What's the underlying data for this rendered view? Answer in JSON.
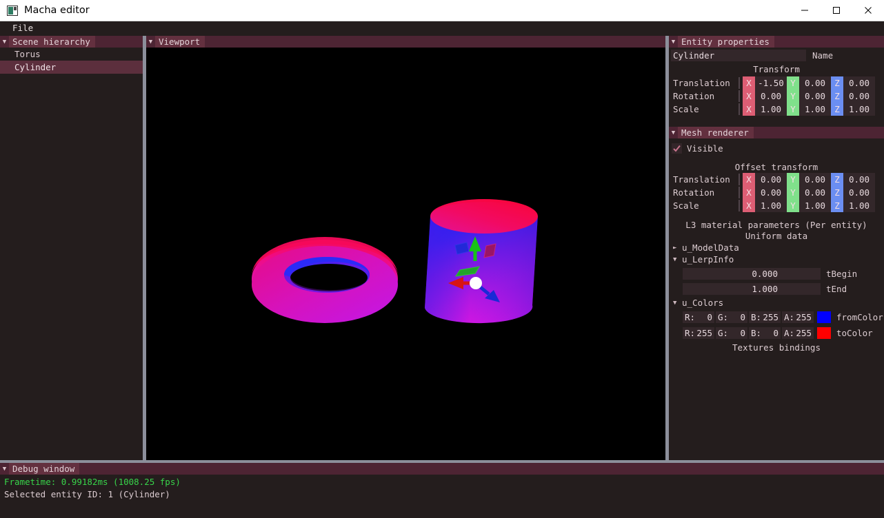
{
  "window": {
    "title": "Macha editor",
    "icon": "app-icon",
    "minimize_label": "minimize-icon",
    "maximize_label": "maximize-icon",
    "close_label": "close-icon"
  },
  "menubar": {
    "file_label": "File"
  },
  "scene_hierarchy": {
    "header": "Scene hierarchy",
    "collapse_glyph": "▼",
    "items": [
      {
        "label": "Torus",
        "selected": false
      },
      {
        "label": "Cylinder",
        "selected": true
      }
    ]
  },
  "viewport": {
    "header": "Viewport",
    "collapse_glyph": "▼",
    "background": "#000000",
    "objects": [
      {
        "name": "torus",
        "color_outer": "#f0138c",
        "color_inner": "#2b2bf5"
      },
      {
        "name": "cylinder",
        "color_top": "#f0136e",
        "color_body_left": "#3a23e8",
        "color_body_bottom": "#d41ae0"
      }
    ],
    "gizmo": {
      "x_axis_color": "#d81414",
      "y_axis_color": "#18c218",
      "z_axis_color": "#1a2ad6",
      "center_color": "#ffffff"
    }
  },
  "entity_properties": {
    "header": "Entity properties",
    "collapse_glyph": "▼",
    "name_value": "Cylinder",
    "name_label": "Name",
    "transform": {
      "title": "Transform",
      "rows": [
        {
          "label": "Translation",
          "x": "-1.50",
          "y": "0.00",
          "z": "0.00"
        },
        {
          "label": "Rotation",
          "x": "0.00",
          "y": "0.00",
          "z": "0.00"
        },
        {
          "label": "Scale",
          "x": "1.00",
          "y": "1.00",
          "z": "1.00"
        }
      ],
      "axis_labels": {
        "x": "X",
        "y": "Y",
        "z": "Z"
      },
      "axis_colors": {
        "x": "#dd5e74",
        "y": "#80e08b",
        "z": "#6b8ef2"
      }
    }
  },
  "mesh_renderer": {
    "header": "Mesh renderer",
    "collapse_glyph": "▼",
    "visible_label": "Visible",
    "visible_checked": true,
    "offset_transform": {
      "title": "Offset transform",
      "rows": [
        {
          "label": "Translation",
          "x": "0.00",
          "y": "0.00",
          "z": "0.00"
        },
        {
          "label": "Rotation",
          "x": "0.00",
          "y": "0.00",
          "z": "0.00"
        },
        {
          "label": "Scale",
          "x": "1.00",
          "y": "1.00",
          "z": "1.00"
        }
      ]
    },
    "material": {
      "title": "L3 material parameters (Per entity)",
      "uniform_title": "Uniform data",
      "nodes": [
        {
          "label": "u_ModelData",
          "arrow": "►",
          "expanded": false
        },
        {
          "label": "u_LerpInfo",
          "arrow": "▼",
          "expanded": true
        }
      ],
      "lerp_fields": [
        {
          "value": "0.000",
          "label": "tBegin"
        },
        {
          "value": "1.000",
          "label": "tEnd"
        }
      ],
      "colors_node": {
        "label": "u_Colors",
        "arrow": "▼",
        "expanded": true
      },
      "colors": [
        {
          "name": "fromColor",
          "swatch": "#0000ff",
          "channels": [
            {
              "key": "R:",
              "value": "0"
            },
            {
              "key": "G:",
              "value": "0"
            },
            {
              "key": "B:",
              "value": "255"
            },
            {
              "key": "A:",
              "value": "255"
            }
          ]
        },
        {
          "name": "toColor",
          "swatch": "#ff0000",
          "channels": [
            {
              "key": "R:",
              "value": "255"
            },
            {
              "key": "G:",
              "value": "0"
            },
            {
              "key": "B:",
              "value": "0"
            },
            {
              "key": "A:",
              "value": "255"
            }
          ]
        }
      ],
      "textures_title": "Textures bindings"
    }
  },
  "debug_window": {
    "header": "Debug window",
    "collapse_glyph": "▼",
    "lines": [
      {
        "text": "Frametime: 0.99182ms (1008.25 fps)",
        "color": "#38d44a"
      },
      {
        "text": "Selected entity ID: 1 (Cylinder)",
        "color": "#ddcdd2"
      }
    ]
  }
}
